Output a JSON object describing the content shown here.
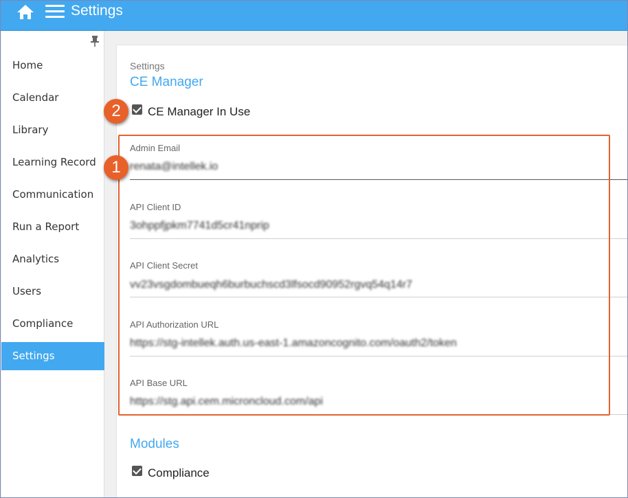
{
  "header": {
    "title": "Settings",
    "home_icon": "home-icon",
    "menu_icon": "hamburger-menu-icon"
  },
  "sidebar": {
    "pin_icon": "pin-icon",
    "items": [
      {
        "label": "Home"
      },
      {
        "label": "Calendar"
      },
      {
        "label": "Library"
      },
      {
        "label": "Learning Record"
      },
      {
        "label": "Communication"
      },
      {
        "label": "Run a Report"
      },
      {
        "label": "Analytics"
      },
      {
        "label": "Users"
      },
      {
        "label": "Compliance"
      },
      {
        "label": "Settings",
        "active": true
      }
    ]
  },
  "main": {
    "breadcrumb": "Settings",
    "ce_manager": {
      "title": "CE Manager",
      "in_use_label": "CE Manager In Use",
      "in_use_checked": true
    },
    "fields": [
      {
        "label": "Admin Email",
        "value": "renata@intellek.io"
      },
      {
        "label": "API Client ID",
        "value": "3ohppfjpkm7741d5cr41nprip"
      },
      {
        "label": "API Client Secret",
        "value": "vv23vsgdombueqh6burbuchscd3lfsocd90952rgvq54q14r7"
      },
      {
        "label": "API Authorization URL",
        "value": "https://stg-intellek.auth.us-east-1.amazoncognito.com/oauth2/token"
      },
      {
        "label": "API Base URL",
        "value": "https://stg.api.cem.microncloud.com/api"
      }
    ],
    "modules": {
      "title": "Modules",
      "compliance_label": "Compliance",
      "compliance_checked": true
    }
  },
  "annotations": {
    "badge_1": "1",
    "badge_2": "2",
    "highlight_color": "#e2622e",
    "badge_color": "#e8612a"
  },
  "colors": {
    "accent": "#42a8f0"
  }
}
